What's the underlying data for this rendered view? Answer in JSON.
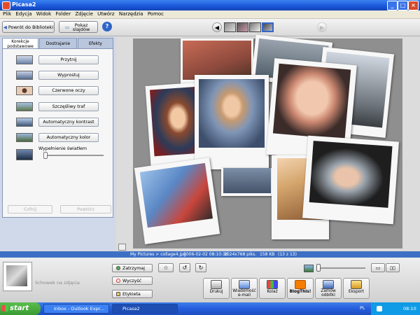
{
  "window": {
    "title": "Picasa2"
  },
  "menu": [
    "Plik",
    "Edycja",
    "Widok",
    "Folder",
    "Zdjęcie",
    "Utwórz",
    "Narzędzia",
    "Pomoc"
  ],
  "toolbar": {
    "back_label": "Powrót do Biblioteki",
    "slideshow_label": "Pokaz slajdów",
    "help_label": "?"
  },
  "tabs": [
    "Korekcje podstawowe",
    "Dostrajanie",
    "Efekty"
  ],
  "tools": [
    "Przytnij",
    "Wyprostuj",
    "Czerwone oczy",
    "Szczęśliwy traf",
    "Automatyczny kontrast",
    "Automatyczny kolor"
  ],
  "fill_light": {
    "label": "Wypełnienie światłem",
    "value": 0
  },
  "undo_label": "Cofnij",
  "redo_label": "Powtórz",
  "infobar": {
    "path": "My Pictures > collage4.jpg",
    "date": "2006-02-02 08:10:16",
    "dims": "1024x768 piks.",
    "size": "158 KB",
    "index": "(13 z 13)"
  },
  "tray": {
    "label": "Schowek na zdjęcia",
    "hold_label": "Zatrzymaj",
    "clear_label": "Wyczyść",
    "tag_label": "Etykieta",
    "actions": [
      "Drukuj",
      "Wiadomość e-mail",
      "Kolaż",
      "BlogThis!",
      "Zamów odbitki",
      "Eksport"
    ]
  },
  "taskbar": {
    "start": "start",
    "tasks": [
      "Inbox - Outlook Expr...",
      "Picasa2"
    ],
    "lang": "PL",
    "time": "08:10"
  },
  "colors": {
    "titlebar": "#1a56d8",
    "infobar": "#3d6fc5",
    "start": "#3a9a33"
  }
}
